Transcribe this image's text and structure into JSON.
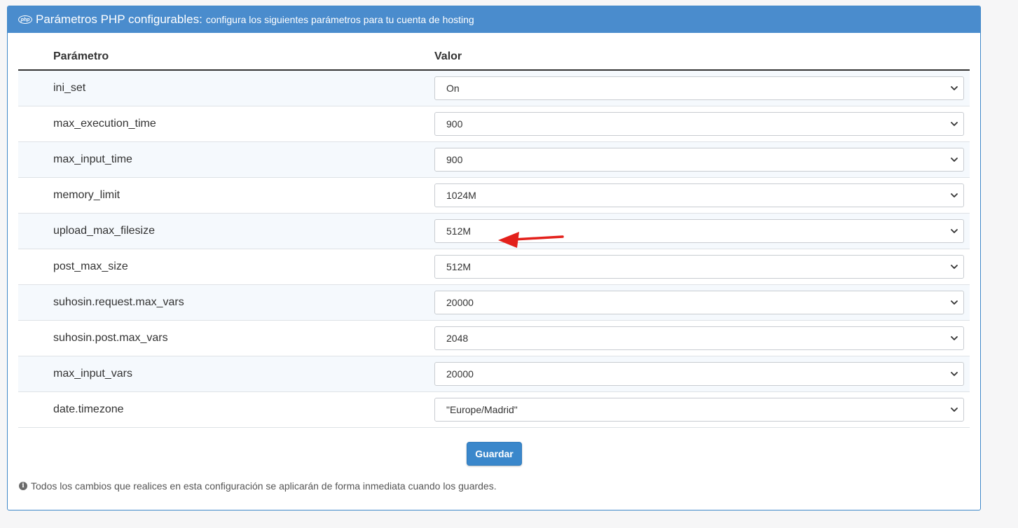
{
  "header": {
    "icon": "php-icon",
    "title": "Parámetros PHP configurables:",
    "subtitle": "configura los siguientes parámetros para tu cuenta de hosting"
  },
  "table": {
    "columns": [
      "Parámetro",
      "Valor"
    ],
    "rows": [
      {
        "name": "ini_set",
        "value": "On"
      },
      {
        "name": "max_execution_time",
        "value": "900"
      },
      {
        "name": "max_input_time",
        "value": "900"
      },
      {
        "name": "memory_limit",
        "value": "1024M"
      },
      {
        "name": "upload_max_filesize",
        "value": "512M"
      },
      {
        "name": "post_max_size",
        "value": "512M"
      },
      {
        "name": "suhosin.request.max_vars",
        "value": "20000"
      },
      {
        "name": "suhosin.post.max_vars",
        "value": "2048"
      },
      {
        "name": "max_input_vars",
        "value": "20000"
      },
      {
        "name": "date.timezone",
        "value": "\"Europe/Madrid\""
      }
    ]
  },
  "save_button": {
    "label": "Guardar"
  },
  "footer": {
    "icon": "info-icon",
    "note": "Todos los cambios que realices en esta configuración se aplicarán de forma inmediata cuando los guardes."
  },
  "colors": {
    "header_bg": "#4a8ccd",
    "button_bg": "#3a87cb",
    "annotation_arrow": "#e3201b",
    "stripe": "#f5f9fd"
  }
}
